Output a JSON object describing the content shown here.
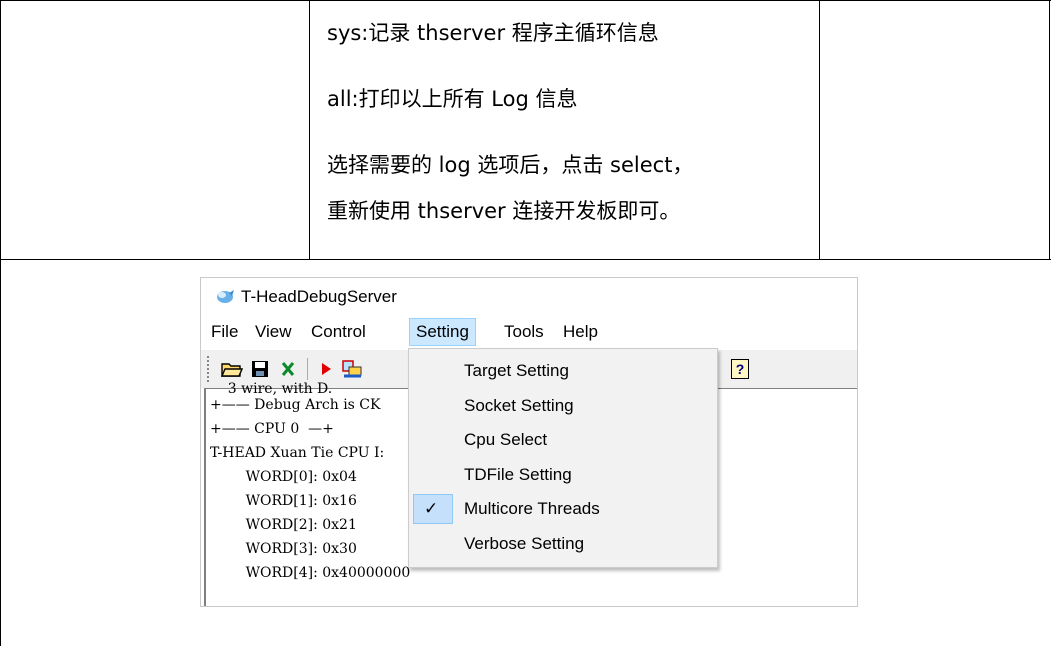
{
  "document": {
    "cell_lines": [
      "sys:记录 thserver 程序主循环信息",
      "all:打印以上所有 Log 信息",
      "选择需要的 log 选项后，点击 select，",
      "重新使用 thserver 连接开发板即可。"
    ]
  },
  "window": {
    "title": "T-HeadDebugServer",
    "menu": [
      {
        "label": "File"
      },
      {
        "label": "View"
      },
      {
        "label": "Control"
      },
      {
        "label": "Setting"
      },
      {
        "label": "Tools"
      },
      {
        "label": "Help"
      }
    ],
    "toolbar": {
      "icons": [
        "open-folder-icon",
        "save-icon",
        "close-x-icon",
        "run-icon",
        "connect-icon",
        "help-icon"
      ],
      "help_label": "?"
    },
    "console_lines": [
      "    3 wire, with D.",
      "+—— Debug Arch is CK",
      "+—— CPU 0  —+",
      "T-HEAD Xuan Tie CPU I:",
      "        WORD[0]: 0x04",
      "        WORD[1]: 0x16",
      "        WORD[2]: 0x21",
      "        WORD[3]: 0x30",
      "        WORD[4]: 0x40000000"
    ],
    "setting_menu": {
      "items": [
        {
          "label": "Target Setting",
          "checked": false
        },
        {
          "label": "Socket Setting",
          "checked": false
        },
        {
          "label": "Cpu Select",
          "checked": false
        },
        {
          "label": "TDFile Setting",
          "checked": false
        },
        {
          "label": "Multicore Threads",
          "checked": true
        },
        {
          "label": "Verbose Setting",
          "checked": false
        }
      ],
      "check_glyph": "✓"
    }
  },
  "colors": {
    "menu_highlight": "#cce8ff",
    "check_highlight": "#c4e0fb",
    "table_border": "#000000"
  }
}
